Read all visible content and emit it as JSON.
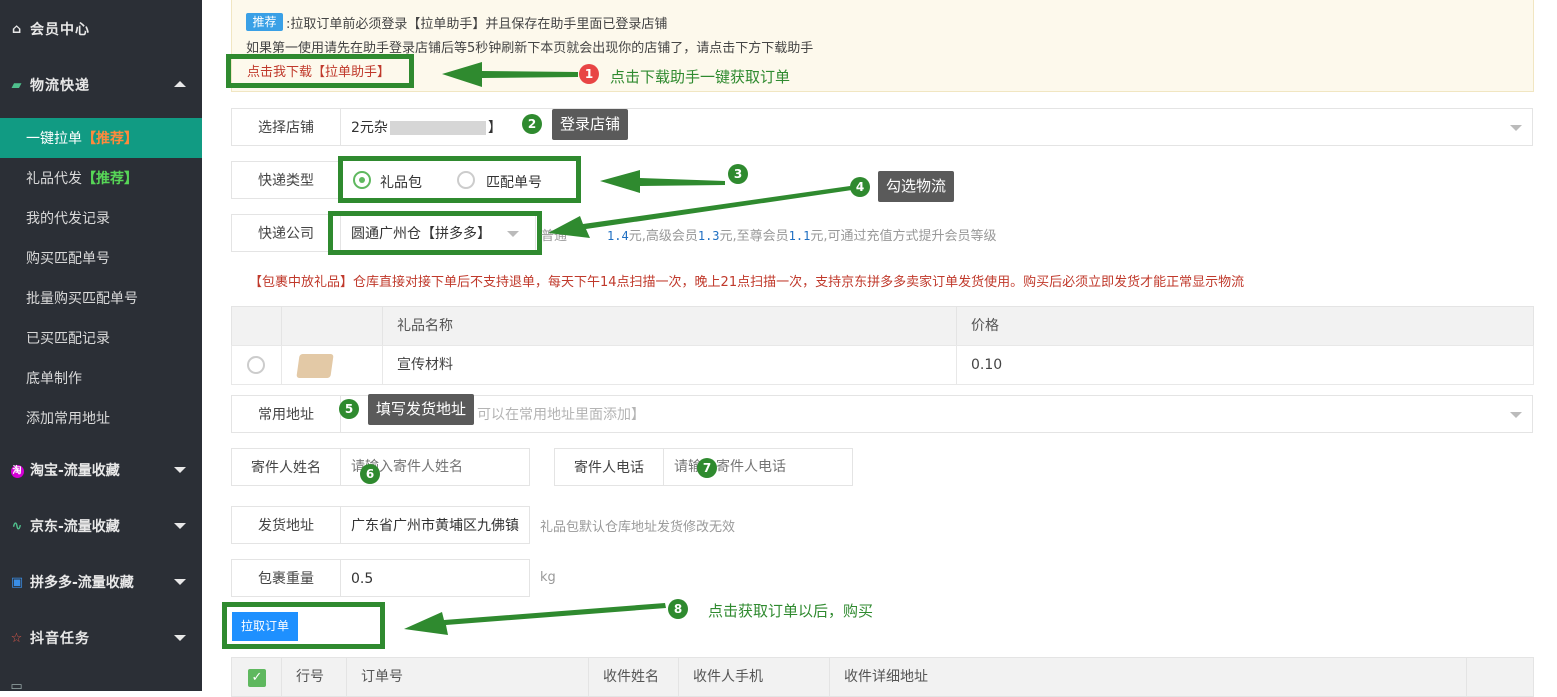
{
  "sidebar": {
    "items": [
      {
        "label": "会员中心",
        "icon": "home-icon"
      },
      {
        "label": "物流快递",
        "icon": "truck-icon"
      },
      {
        "label": "淘宝-流量收藏",
        "icon": "taobao-icon"
      },
      {
        "label": "京东-流量收藏",
        "icon": "pulse-icon"
      },
      {
        "label": "拼多多-流量收藏",
        "icon": "pdd-icon"
      },
      {
        "label": "抖音任务",
        "icon": "star-icon"
      }
    ],
    "sub": [
      {
        "label": "一键拉单",
        "tag": "【推荐】"
      },
      {
        "label": "礼品代发",
        "tag": "【推荐】"
      },
      {
        "label": "我的代发记录"
      },
      {
        "label": "购买匹配单号"
      },
      {
        "label": "批量购买匹配单号"
      },
      {
        "label": "已买匹配记录"
      },
      {
        "label": "底单制作"
      },
      {
        "label": "添加常用地址"
      }
    ]
  },
  "notice": {
    "badge": "推荐",
    "line1": ":拉取订单前必须登录【拉单助手】并且保存在助手里面已登录店铺",
    "line2": "如果第一使用请先在助手登录店铺后等5秒钟刷新下本页就会出现你的店铺了，请点击下方下载助手",
    "download_link": "点击我下载【拉单助手】"
  },
  "annotations": {
    "n1": "1",
    "a1": "点击下载助手一键获取订单",
    "n2": "2",
    "a2": "登录店铺",
    "n3": "3",
    "n4": "4",
    "a4": "勾选物流",
    "n5": "5",
    "a5": "填写发货地址",
    "n6": "6",
    "n7": "7",
    "n8": "8",
    "a8": "点击获取订单以后，购买"
  },
  "form": {
    "shop_label": "选择店铺",
    "shop_value": "2元杂",
    "shop_value_tail": "】",
    "type_label": "快递类型",
    "type_option1": "礼品包",
    "type_option2": "匹配单号",
    "company_label": "快递公司",
    "company_value": "圆通广州仓【拼多多】",
    "price_p1": "普通",
    "price_v1": "1.4",
    "price_p2": "元,高级会员",
    "price_v2": "1.3",
    "price_p3": "元,至尊会员",
    "price_v3": "1.1",
    "price_p4": "元,可通过充值方式提升会员等级",
    "warning": "【包裹中放礼品】仓库直接对接下单后不支持退单，每天下午14点扫描一次，晚上21点扫描一次，支持京东拼多多卖家订单发货使用。购买后必须立即发货才能正常显示物流",
    "addr_label": "常用地址",
    "addr_placeholder": "可以在常用地址里面添加】",
    "sender_name_label": "寄件人姓名",
    "sender_name_placeholder": "请输入寄件人姓名",
    "sender_phone_label": "寄件人电话",
    "sender_phone_placeholder": "请输入寄件人电话",
    "ship_label": "发货地址",
    "ship_value": "广东省广州市黄埔区九佛镇",
    "ship_hint": "礼品包默认仓库地址发货修改无效",
    "weight_label": "包裹重量",
    "weight_value": "0.5",
    "weight_unit": "kg",
    "fetch_button": "拉取订单"
  },
  "gift_table": {
    "headers": [
      "礼品名称",
      "价格"
    ],
    "rows": [
      {
        "name": "宣传材料",
        "price": "0.10"
      }
    ]
  },
  "order_table": {
    "headers": [
      "行号",
      "订单号",
      "收件姓名",
      "收件人手机",
      "收件详细地址"
    ]
  },
  "colors": {
    "sidebar_bg": "#2b2f36",
    "active": "#119b83",
    "annotation_green": "#2f8a2f",
    "warning_red": "#c0392b"
  }
}
